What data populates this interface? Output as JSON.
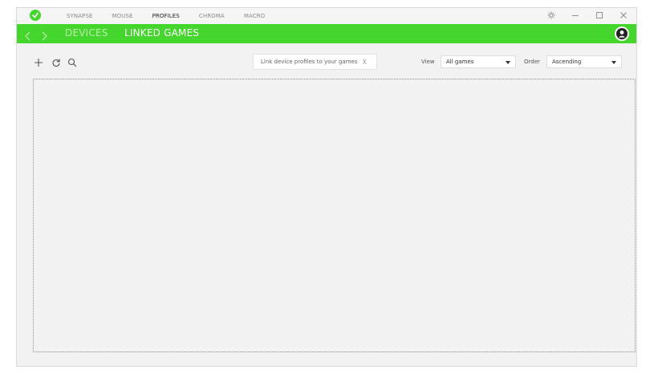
{
  "titlebar": {
    "tabs": [
      {
        "label": "SYNAPSE"
      },
      {
        "label": "MOUSE"
      },
      {
        "label": "PROFILES"
      },
      {
        "label": "CHROMA"
      },
      {
        "label": "MACRO"
      }
    ],
    "active_tab": "PROFILES"
  },
  "subnav": {
    "devices_label": "DEVICES",
    "linked_games_label": "LINKED GAMES"
  },
  "toolbar": {
    "hint_text": "Link device profiles to your games",
    "hint_close": "X",
    "view_label": "View",
    "view_value": "All games",
    "order_label": "Order",
    "order_value": "Ascending"
  },
  "colors": {
    "accent": "#44d62c",
    "background": "#f2f2f2"
  },
  "icons": [
    "razer-logo-icon",
    "settings-icon",
    "minimize-icon",
    "maximize-icon",
    "close-icon",
    "back-arrow-icon",
    "forward-arrow-icon",
    "user-avatar-icon",
    "add-icon",
    "refresh-icon",
    "search-icon"
  ]
}
